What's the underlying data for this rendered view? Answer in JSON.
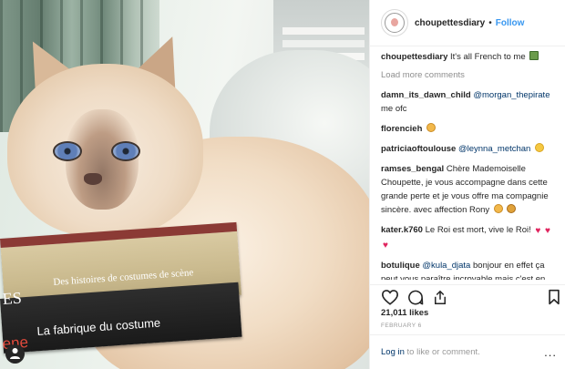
{
  "header": {
    "username": "choupettesdiary",
    "separator": "•",
    "follow_label": "Follow"
  },
  "caption": {
    "username": "choupettesdiary",
    "text": "It's all French to me"
  },
  "load_more_label": "Load more comments",
  "comments": [
    {
      "user": "damn_its_dawn_child",
      "mention": "@morgan_thepirate",
      "text": "me ofc"
    },
    {
      "user": "florencieh",
      "text": ""
    },
    {
      "user": "patriciaoftoulouse",
      "mention": "@leynna_metchan",
      "text": ""
    },
    {
      "user": "ramses_bengal",
      "text": "Chère Mademoiselle Choupette, je vous accompagne dans cette grande perte et je vous offre ma compagnie sincère. avec affection Rony"
    },
    {
      "user": "kater.k760",
      "text": "Le Roi est mort, vive le Roi!"
    },
    {
      "user": "botulique",
      "mention": "@kula_djata",
      "text": "bonjour en effet ça peut vous paraître incroyable mais c'est en quelque sorte l'enfant de Mr Lagerfeld donc nous pensons à Choupette cette page s'y prête et permet de rendre hommage au"
    }
  ],
  "likes": "21,011 likes",
  "date": "FEBRUARY 6",
  "login": {
    "link": "Log in",
    "rest": "to like or comment."
  },
  "more_label": "...",
  "photo": {
    "book1_title": "Des histoires de costumes de scène",
    "book1_partial": "ES",
    "book2_title": "La fabrique du costume",
    "book2_partial": "ene"
  },
  "colors": {
    "follow": "#3897f0",
    "mention": "#003569",
    "heart": "#e0245e"
  }
}
